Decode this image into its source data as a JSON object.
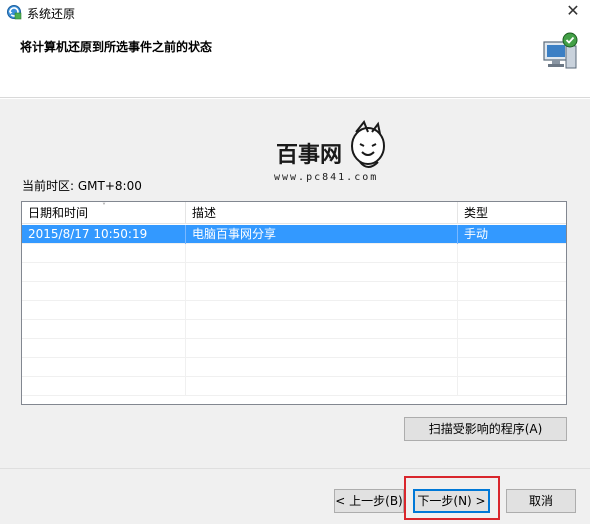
{
  "window": {
    "title": "系统还原",
    "close_glyph": "✕",
    "header_title": "将计算机还原到所选事件之前的状态"
  },
  "logo": {
    "main_text": "百事网",
    "url_text": "www.pc841.com"
  },
  "timezone": {
    "label": "当前时区: GMT+8:00"
  },
  "table": {
    "columns": [
      "日期和时间",
      "描述",
      "类型"
    ],
    "sort_indicator": "˅",
    "rows": [
      {
        "datetime": "2015/8/17 10:50:19",
        "description": "电脑百事网分享",
        "type": "手动",
        "selected": true
      }
    ]
  },
  "buttons": {
    "scan": "扫描受影响的程序(A)",
    "back": "< 上一步(B)",
    "next": "下一步(N) >",
    "cancel": "取消"
  },
  "colors": {
    "selection": "#3399ff",
    "highlight_box": "#d9262c",
    "accent": "#0078d7"
  }
}
